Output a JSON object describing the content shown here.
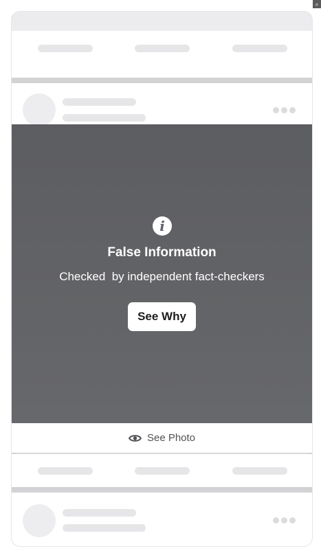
{
  "overlay": {
    "title": "False Information",
    "subtitle": "Checked  by independent fact-checkers",
    "button_label": "See Why",
    "info_glyph": "i"
  },
  "footer": {
    "see_photo_label": "See Photo",
    "see_photo_icon": "eye-icon"
  },
  "colors": {
    "overlay_bg": "#5f6063",
    "card_bg": "#ffffff",
    "placeholder": "#e6e6e8",
    "frame": "#d3d3d5"
  }
}
